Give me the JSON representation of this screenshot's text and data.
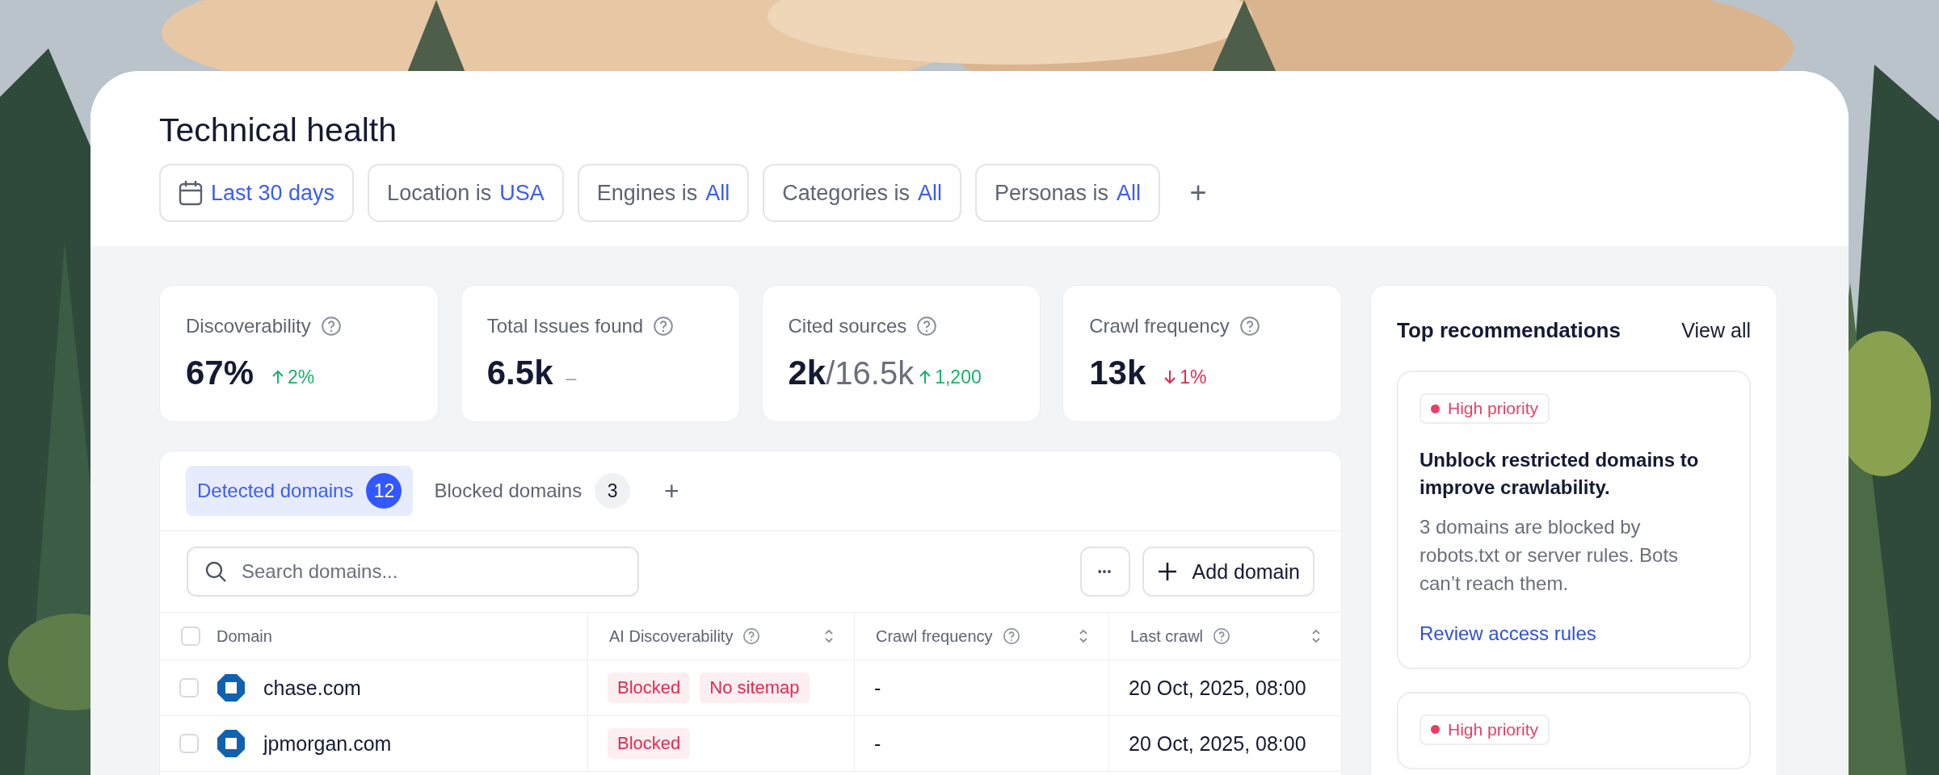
{
  "title": "Technical health",
  "filters": [
    {
      "kind": "date",
      "value": "Last 30 days"
    },
    {
      "kind": "field",
      "label": "Location is",
      "value": "USA"
    },
    {
      "kind": "field",
      "label": "Engines is",
      "value": "All"
    },
    {
      "kind": "field",
      "label": "Categories is",
      "value": "All"
    },
    {
      "kind": "field",
      "label": "Personas is",
      "value": "All"
    }
  ],
  "add_filter": "+",
  "stats": [
    {
      "label": "Discoverability",
      "value": "67%",
      "kind": "up",
      "delta": "2%"
    },
    {
      "label": "Total Issues found",
      "value": "6.5k",
      "kind": "flat",
      "delta": "–"
    },
    {
      "label": "Cited sources",
      "value": "2k",
      "total": "/16.5k",
      "kind": "up",
      "delta": "1,200"
    },
    {
      "label": "Crawl frequency",
      "value": "13k",
      "kind": "down",
      "delta": "1%"
    }
  ],
  "tabs": [
    {
      "label": "Detected domains",
      "count": "12",
      "selected": true
    },
    {
      "label": "Blocked domains",
      "count": "3",
      "selected": false
    }
  ],
  "add_tab": "+",
  "search": {
    "placeholder": "Search domains..."
  },
  "more_button": "•••",
  "add_button": "Add domain",
  "table": {
    "all_checked": false,
    "columns": [
      {
        "label": "Domain",
        "kind": "plain"
      },
      {
        "label": "AI Discoverability",
        "kind": "sortable"
      },
      {
        "label": "Crawl frequency",
        "kind": "sortable"
      },
      {
        "label": "Last crawl",
        "kind": "sortable"
      }
    ],
    "rows": [
      {
        "checked": false,
        "domain": "chase.com",
        "tags": [
          "Blocked",
          "No sitemap"
        ],
        "crawl_frequency": "-",
        "last_crawl": "20 Oct, 2025, 08:00"
      },
      {
        "checked": false,
        "domain": "jpmorgan.com",
        "tags": [
          "Blocked"
        ],
        "crawl_frequency": "-",
        "last_crawl": "20 Oct, 2025, 08:00"
      }
    ]
  },
  "recommendations": {
    "title": "Top recommendations",
    "view_all": "View all",
    "items": [
      {
        "priority": "High priority",
        "color": "#ec3d63",
        "title": "Unblock restricted domains to improve crawlability.",
        "body": "3 domains are blocked by robots.txt or server rules. Bots can’t reach them.",
        "link": "Review access rules"
      },
      {
        "priority": "High priority",
        "color": "#ec3d63"
      }
    ]
  }
}
